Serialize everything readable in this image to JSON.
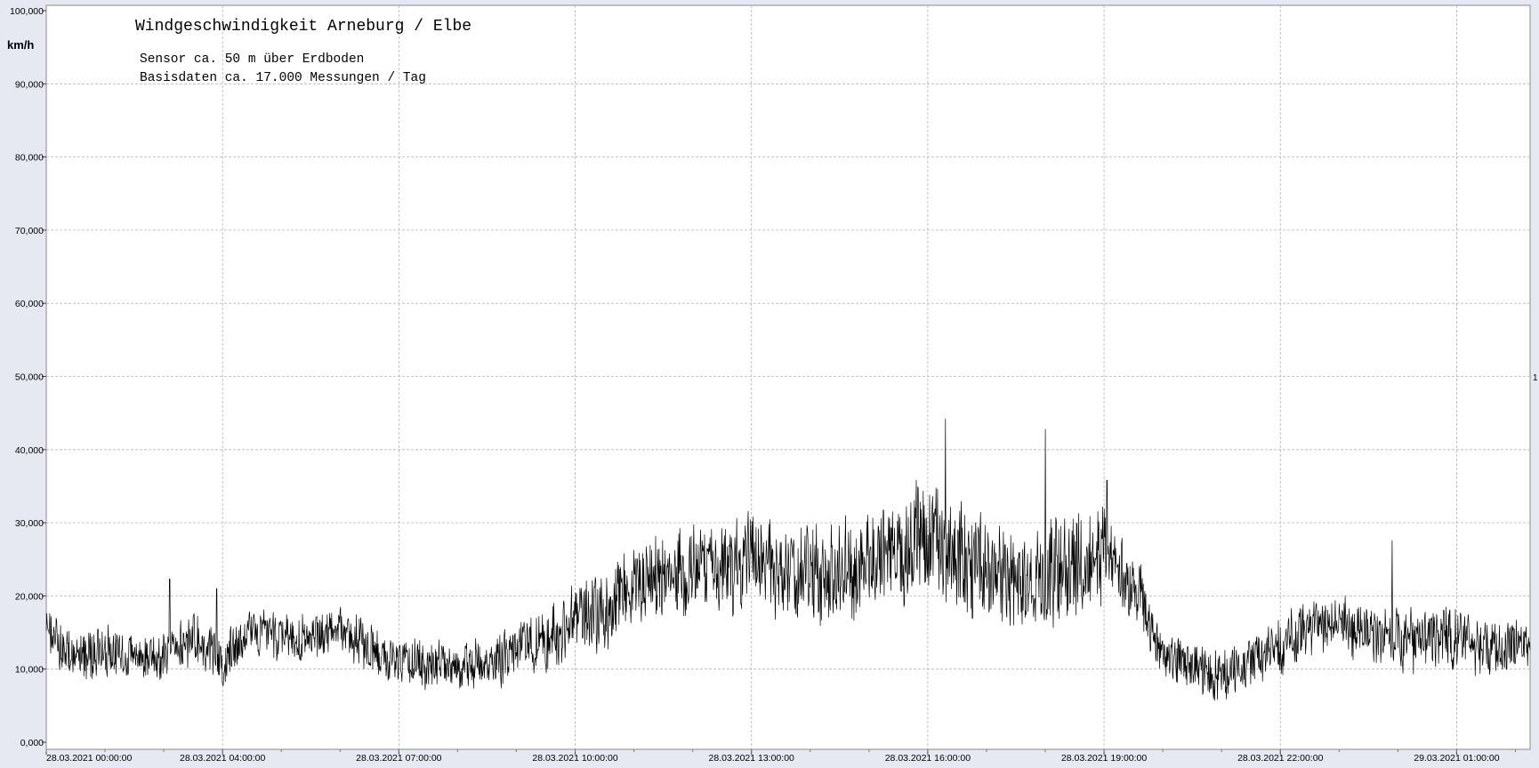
{
  "chart_data": {
    "type": "line",
    "title": "Windgeschwindigkeit  Arneburg / Elbe",
    "subtitles": [
      "Sensor ca. 50 m über Erdboden",
      "Basisdaten ca. 17.000 Messungen / Tag"
    ],
    "ylabel": "km/h",
    "ylim": [
      0,
      100
    ],
    "y_ticks": [
      "0,000",
      "10,000",
      "20,000",
      "30,000",
      "40,000",
      "50,000",
      "60,000",
      "70,000",
      "80,000",
      "90,000",
      "100,000"
    ],
    "x_range_hours": [
      0,
      25.25
    ],
    "x_ticks": [
      {
        "hour": 0,
        "label": "28.03.2021  00:00:00"
      },
      {
        "hour": 3,
        "label": "28.03.2021  04:00:00"
      },
      {
        "hour": 6,
        "label": "28.03.2021  07:00:00"
      },
      {
        "hour": 9,
        "label": "28.03.2021  10:00:00"
      },
      {
        "hour": 12,
        "label": "28.03.2021  13:00:00"
      },
      {
        "hour": 15,
        "label": "28.03.2021  16:00:00"
      },
      {
        "hour": 18,
        "label": "28.03.2021  19:00:00"
      },
      {
        "hour": 21,
        "label": "28.03.2021  22:00:00"
      },
      {
        "hour": 24,
        "label": "29.03.2021  01:00:00"
      }
    ],
    "right_marker": "1",
    "grid": true,
    "series": [
      {
        "color": "#000000",
        "envelope_hours": [
          0,
          0.2,
          0.5,
          1,
          1.5,
          2,
          2.5,
          3,
          3.5,
          4,
          4.5,
          5,
          5.5,
          6,
          6.5,
          7,
          7.5,
          8,
          8.5,
          9,
          9.5,
          10,
          10.5,
          11,
          11.5,
          12,
          12.5,
          13,
          13.5,
          14,
          14.5,
          15,
          15.5,
          16,
          16.5,
          17,
          17.5,
          18,
          18.5,
          19,
          19.5,
          20,
          20.5,
          21,
          21.5,
          22,
          22.5,
          23,
          23.5,
          24,
          24.5,
          25,
          25.25
        ],
        "envelope_mean": [
          17,
          13,
          12,
          12.5,
          12,
          11.5,
          14,
          11.5,
          15,
          14.5,
          14.5,
          15.5,
          13,
          11,
          10.5,
          10.5,
          10,
          13,
          14,
          17,
          18,
          22,
          23,
          24,
          23.5,
          25,
          23,
          24,
          23,
          25,
          26,
          28,
          26,
          23,
          22,
          23,
          24,
          25,
          22,
          12,
          10,
          9,
          11,
          13,
          15.5,
          16,
          15,
          14,
          14,
          14,
          13.5,
          13,
          13
        ],
        "envelope_amp": [
          4,
          4,
          4,
          4,
          4,
          4,
          4.5,
          4,
          4,
          4,
          4,
          3.5,
          4,
          4,
          4,
          4,
          4,
          4.5,
          5,
          6,
          6.5,
          7,
          7,
          7,
          7,
          7,
          7,
          8,
          8,
          8.5,
          9,
          9,
          9,
          8.5,
          8,
          8.5,
          8.5,
          7.5,
          6,
          4,
          4,
          4,
          4,
          4.5,
          4.5,
          4.5,
          4.5,
          5,
          5,
          5,
          4.5,
          4.5,
          4.5
        ],
        "peaks": [
          {
            "hour": 2.1,
            "value": 22.3
          },
          {
            "hour": 2.9,
            "value": 21.0
          },
          {
            "hour": 15.3,
            "value": 44.2
          },
          {
            "hour": 17.0,
            "value": 42.8
          },
          {
            "hour": 18.05,
            "value": 35.8
          },
          {
            "hour": 22.9,
            "value": 27.6
          }
        ]
      }
    ]
  }
}
